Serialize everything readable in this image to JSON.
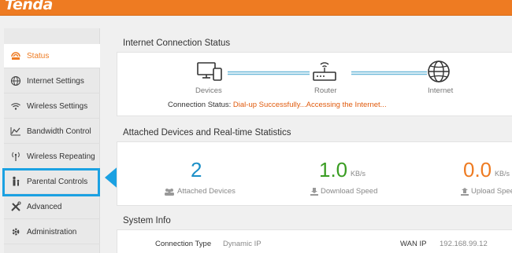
{
  "brand": {
    "logo_text": "Tenda",
    "accent": "#ee7b22",
    "highlight": "#1ba1e2"
  },
  "sidebar": {
    "items": [
      {
        "label": "Status",
        "icon": "status-icon",
        "active": true
      },
      {
        "label": "Internet Settings",
        "icon": "globe-icon"
      },
      {
        "label": "Wireless Settings",
        "icon": "wifi-icon"
      },
      {
        "label": "Bandwidth Control",
        "icon": "chart-icon"
      },
      {
        "label": "Wireless Repeating",
        "icon": "antenna-icon"
      },
      {
        "label": "Parental Controls",
        "icon": "parent-child-icon"
      },
      {
        "label": "Advanced",
        "icon": "tools-icon"
      },
      {
        "label": "Administration",
        "icon": "gear-icon"
      }
    ]
  },
  "internet_status": {
    "title": "Internet Connection Status",
    "devices_label": "Devices",
    "router_label": "Router",
    "internet_label": "Internet",
    "connection_status_label": "Connection Status:",
    "connection_status_value": "Dial-up Successfully...Accessing the Internet..."
  },
  "stats": {
    "title": "Attached Devices and Real-time Statistics",
    "attached_count": "2",
    "attached_label": "Attached Devices",
    "download_value": "1.0",
    "download_unit": "KB/s",
    "download_label": "Download Speed",
    "upload_value": "0.0",
    "upload_unit": "KB/s",
    "upload_label": "Upload Spee",
    "colors": {
      "attached": "#1b8fc7",
      "download": "#3a9d23",
      "upload": "#ee7b22"
    }
  },
  "system_info": {
    "title": "System Info",
    "connection_type_label": "Connection Type",
    "connection_type_value": "Dynamic IP",
    "wan_ip_label": "WAN IP",
    "wan_ip_value": "192.168.99.12"
  }
}
